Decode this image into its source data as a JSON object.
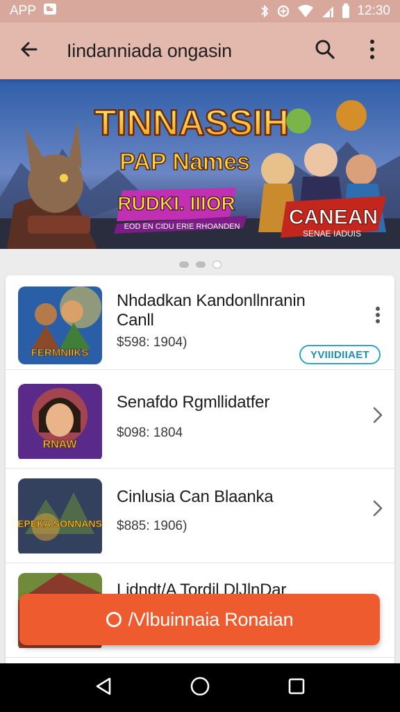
{
  "status_bar": {
    "app_label": "APP",
    "time": "12:30"
  },
  "app_bar": {
    "title": "Iindanniada ongasin"
  },
  "banner": {
    "headline": "TINNASSIH",
    "tagline": "PAP Names",
    "ribbon": "RUDKI. IIIOR",
    "subtext": "EOD EN CIDU ERIE RHOANDEN",
    "badge_main": "CANEAN",
    "badge_sub": "SENAE IADUIS"
  },
  "carousel": {
    "count": 3,
    "active_index": 1
  },
  "list": [
    {
      "thumb_label": "FERMNIIKS",
      "title_line1": "Nhdadkan Kandonllnranin",
      "title_line2": "Canll",
      "price": "$598: 1904)",
      "badge": "YVIIIDIIAET",
      "action": "more"
    },
    {
      "thumb_label": "RNAW",
      "title_line1": "Senafdo Rgmllidatfer",
      "title_line2": "",
      "price": "$098: 1804",
      "badge": "",
      "action": "chevron"
    },
    {
      "thumb_label": "EPEKA SONNANS",
      "title_line1": "Cinlusia Can Blaanka",
      "title_line2": "",
      "price": "$885: 1906)",
      "badge": "",
      "action": "chevron"
    },
    {
      "thumb_label": "",
      "title_line1": "Lidndt/A Tordil DlJlnDar",
      "title_line2": "",
      "price": "",
      "badge": "",
      "action": "none"
    }
  ],
  "fab": {
    "label": "/Vlbuinnaia Ronaian"
  },
  "colors": {
    "status_bar": "#d9a89c",
    "app_bar": "#e2b9ac",
    "accent": "#ed5b2e",
    "badge": "#2aa6c8"
  },
  "icons": {
    "back": "arrow-back-icon",
    "search": "search-icon",
    "more": "more-vert-icon",
    "chevron": "chevron-right-icon",
    "nav_back": "nav-back-icon",
    "nav_home": "nav-home-icon",
    "nav_recents": "nav-recents-icon"
  }
}
